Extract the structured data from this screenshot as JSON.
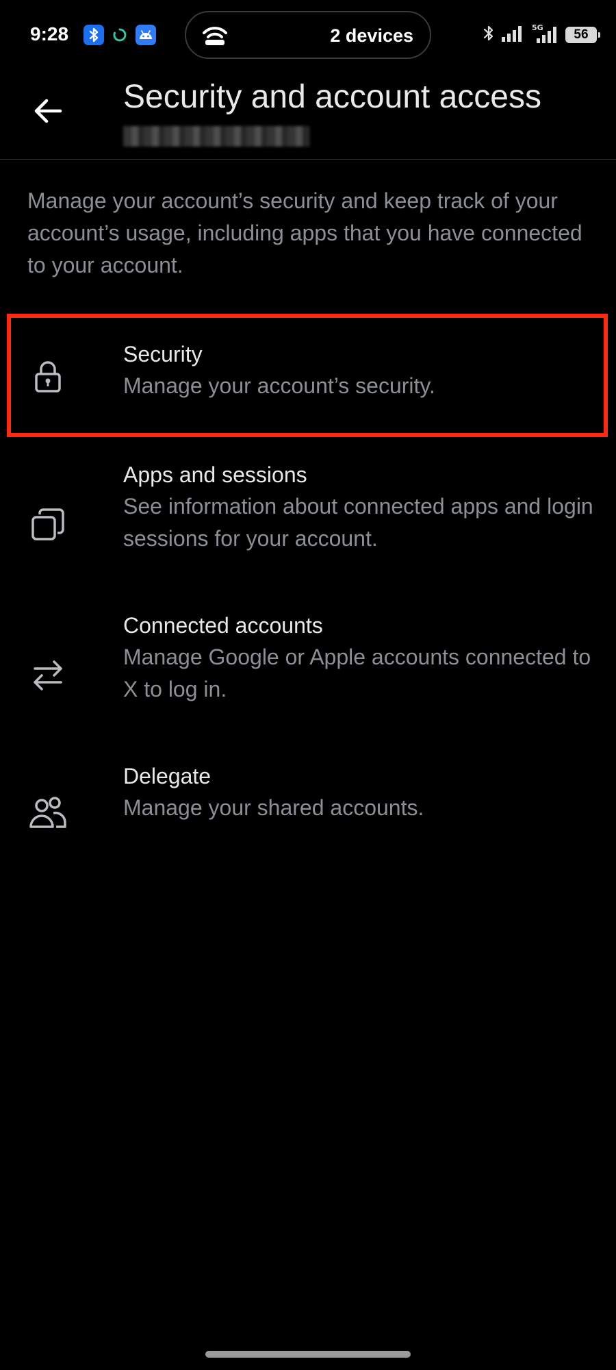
{
  "status_bar": {
    "time": "9:28",
    "pill_label": "2 devices",
    "battery": "56",
    "network": "5G",
    "icons": [
      "bluetooth-app-icon",
      "sync-icon",
      "android-app-icon",
      "hotspot-icon",
      "bluetooth-icon",
      "signal-icon",
      "signal-5g-icon",
      "battery-icon"
    ]
  },
  "header": {
    "title": "Security and account access",
    "back_icon": "arrow-left-icon"
  },
  "intro_text": "Manage your account’s security and keep track of your account’s usage, including apps that you have connected to your account.",
  "menu": [
    {
      "title": "Security",
      "subtitle": "Manage your account’s security.",
      "icon": "lock-icon"
    },
    {
      "title": "Apps and sessions",
      "subtitle": "See information about connected apps and login sessions for your account.",
      "icon": "copy-windows-icon"
    },
    {
      "title": "Connected accounts",
      "subtitle": "Manage Google or Apple accounts connected to X to log in.",
      "icon": "swap-arrows-icon"
    },
    {
      "title": "Delegate",
      "subtitle": "Manage your shared accounts.",
      "icon": "people-icon"
    }
  ],
  "colors": {
    "background": "#000000",
    "primary_text": "#e7e9ea",
    "secondary_text": "#8b9097",
    "highlight": "#ff2a13"
  }
}
